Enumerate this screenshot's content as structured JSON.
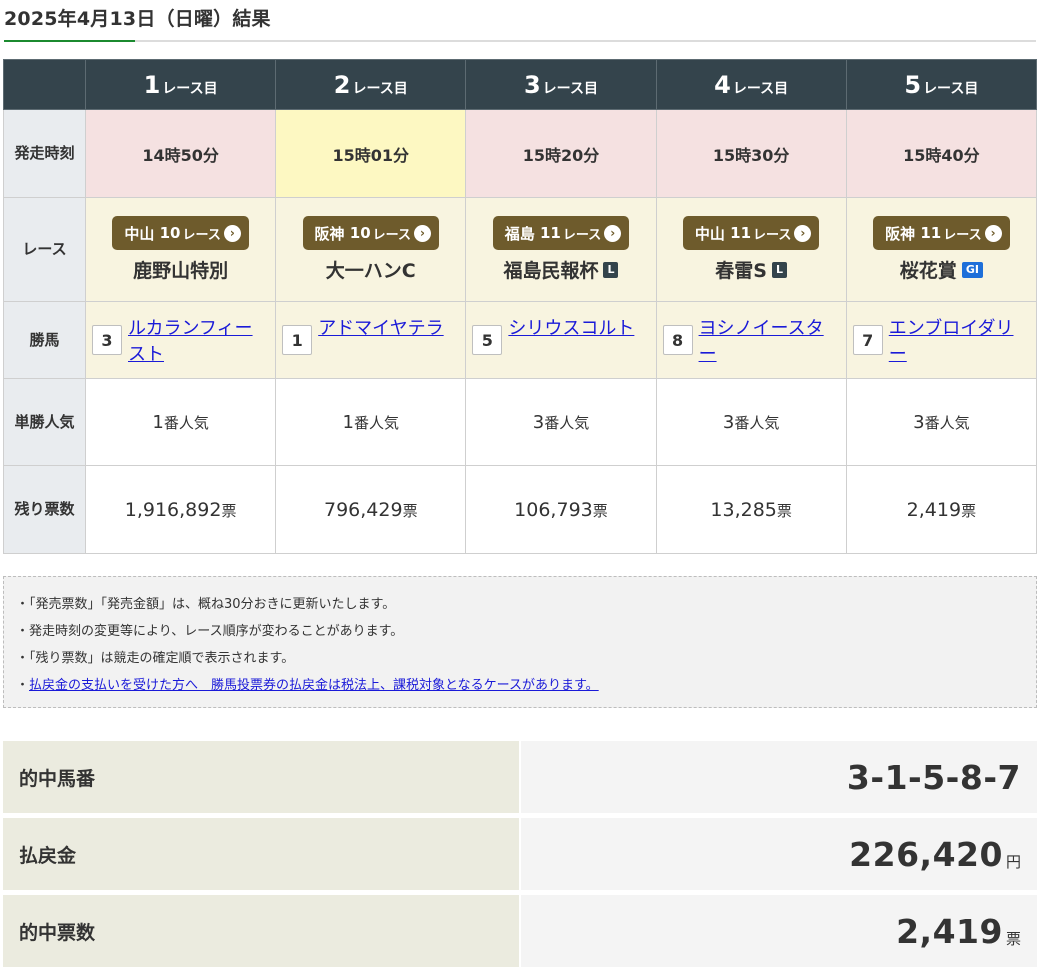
{
  "page": {
    "title": "2025年4月13日（日曜）結果"
  },
  "table": {
    "race_suffix": "レース目",
    "row_labels": {
      "start_time": "発走時刻",
      "race": "レース",
      "winner": "勝馬",
      "popularity": "単勝人気",
      "remaining": "残り票数"
    },
    "races": [
      {
        "num": "1",
        "start": "14時50分",
        "venue": "中山",
        "venue_race": "10",
        "badge_suffix": "レース",
        "name": "鹿野山特別",
        "grade": "",
        "winner_no": "3",
        "winner": "ルカランフィースト",
        "pop_num": "1",
        "pop_suffix": "番人気",
        "votes": "1,916,892",
        "votes_unit": "票"
      },
      {
        "num": "2",
        "start": "15時01分",
        "venue": "阪神",
        "venue_race": "10",
        "badge_suffix": "レース",
        "name": "大一ハンC",
        "grade": "",
        "winner_no": "1",
        "winner": "アドマイヤテラ",
        "pop_num": "1",
        "pop_suffix": "番人気",
        "votes": "796,429",
        "votes_unit": "票"
      },
      {
        "num": "3",
        "start": "15時20分",
        "venue": "福島",
        "venue_race": "11",
        "badge_suffix": "レース",
        "name": "福島民報杯",
        "grade": "L",
        "winner_no": "5",
        "winner": "シリウスコルト",
        "pop_num": "3",
        "pop_suffix": "番人気",
        "votes": "106,793",
        "votes_unit": "票"
      },
      {
        "num": "4",
        "start": "15時30分",
        "venue": "中山",
        "venue_race": "11",
        "badge_suffix": "レース",
        "name": "春雷S",
        "grade": "L",
        "winner_no": "8",
        "winner": "ヨシノイースター",
        "pop_num": "3",
        "pop_suffix": "番人気",
        "votes": "13,285",
        "votes_unit": "票"
      },
      {
        "num": "5",
        "start": "15時40分",
        "venue": "阪神",
        "venue_race": "11",
        "badge_suffix": "レース",
        "name": "桜花賞",
        "grade": "GI",
        "winner_no": "7",
        "winner": "エンブロイダリー",
        "pop_num": "3",
        "pop_suffix": "番人気",
        "votes": "2,419",
        "votes_unit": "票"
      }
    ]
  },
  "notes": [
    "・「発売票数」「発売金額」は、概ね30分おきに更新いたします。",
    "・発走時刻の変更等により、レース順序が変わることがあります。",
    "・「残り票数」は競走の確定順で表示されます。"
  ],
  "note_link": {
    "bullet": "・",
    "text": "払戻金の支払いを受けた方へ　勝馬投票券の払戻金は税法上、課税対象となるケースがあります。"
  },
  "summary": {
    "numbers_label": "的中馬番",
    "numbers_value": "3-1-5-8-7",
    "payout_label": "払戻金",
    "payout_value": "226,420",
    "payout_unit": "円",
    "tickets_label": "的中票数",
    "tickets_value": "2,419",
    "tickets_unit": "票"
  },
  "colors": {
    "header_bg": "#34444c",
    "badge_bg": "#6e5b2c",
    "pink_cell": "#f5e1e1",
    "yellow_cell": "#fdf8c2",
    "cream_cell": "#f8f4e0",
    "accent_green": "#1b8a2f",
    "link": "#1a1ad8"
  }
}
